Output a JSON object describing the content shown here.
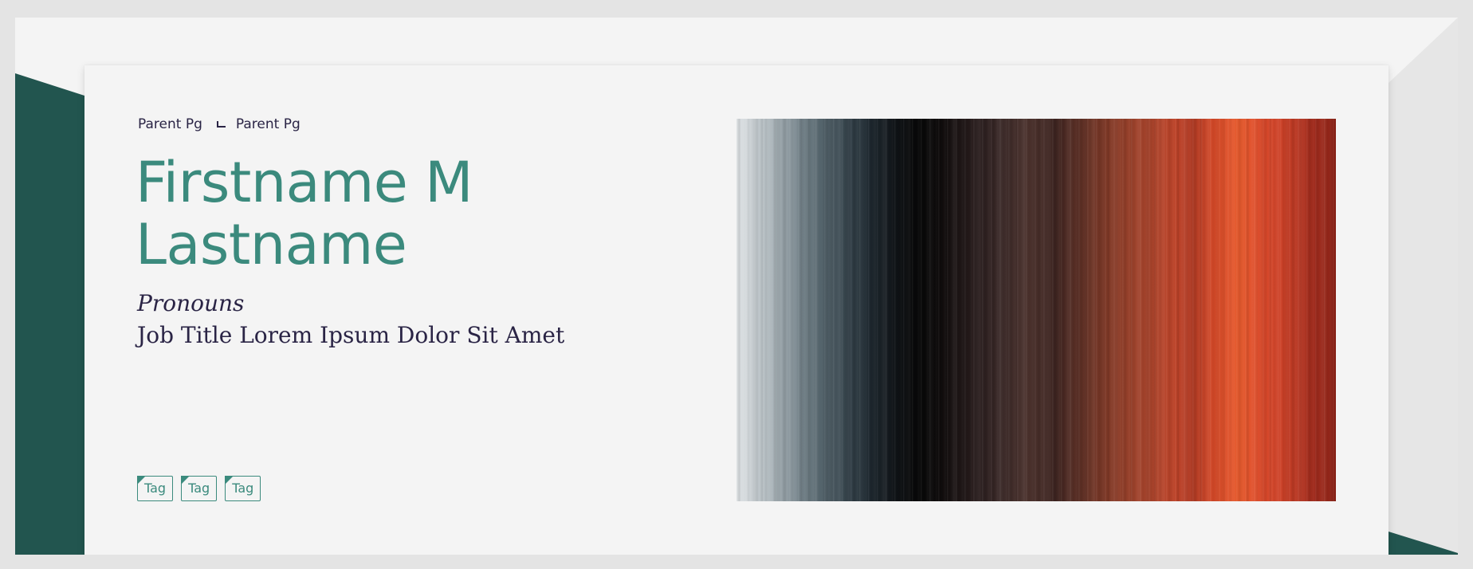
{
  "profile": {
    "breadcrumb": [
      {
        "label": "Parent Pg"
      },
      {
        "label": "Parent Pg"
      }
    ],
    "name_line1": "Firstname M",
    "name_line2": "Lastname",
    "pronouns": "Pronouns",
    "job_title": "Job Title Lorem Ipsum Dolor Sit Amet",
    "tags": [
      {
        "label": "Tag"
      },
      {
        "label": "Tag"
      },
      {
        "label": "Tag"
      }
    ],
    "hero_image_icon": "abstract-streak-photo-icon"
  },
  "colors": {
    "accent": "#3b8a7d",
    "deep_green": "#22554f",
    "text_dark": "#2a2445",
    "background": "#f4f4f4"
  }
}
